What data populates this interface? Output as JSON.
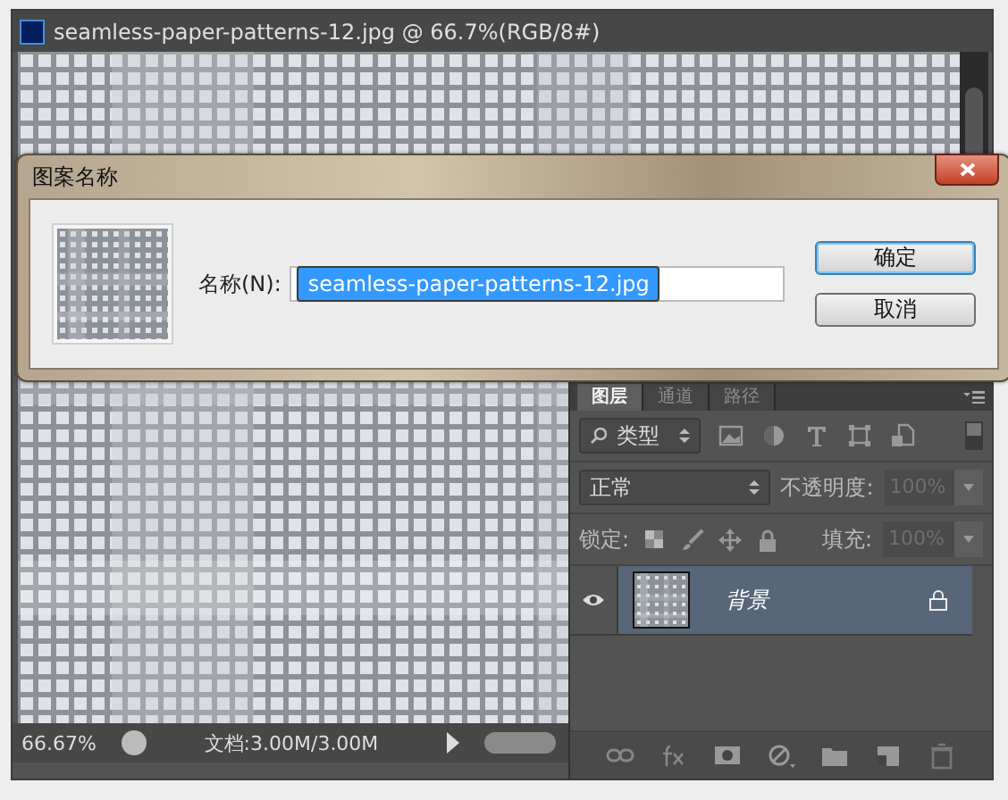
{
  "document": {
    "title": "seamless-paper-patterns-12.jpg @ 66.7%(RGB/8#)",
    "zoom": "66.67%",
    "doc_size": "文档:3.00M/3.00M"
  },
  "dialog": {
    "title": "图案名称",
    "field_label": "名称(N):",
    "value": "seamless-paper-patterns-12.jpg",
    "value_selected": true,
    "buttons": [
      {
        "label": "确定",
        "default": true
      },
      {
        "label": "取消",
        "default": false
      }
    ]
  },
  "layers_panel": {
    "tabs": [
      {
        "label": "图层",
        "selected": true
      },
      {
        "label": "通道",
        "selected": false
      },
      {
        "label": "路径",
        "selected": false
      }
    ],
    "filter": "类型",
    "blend_mode": "正常",
    "opacity_label": "不透明度:",
    "opacity": "100%",
    "lock_label": "锁定:",
    "fill_label": "填充:",
    "fill": "100%",
    "layers": [
      {
        "name": "背景",
        "visible": true,
        "locked": true,
        "selected": true
      }
    ]
  }
}
